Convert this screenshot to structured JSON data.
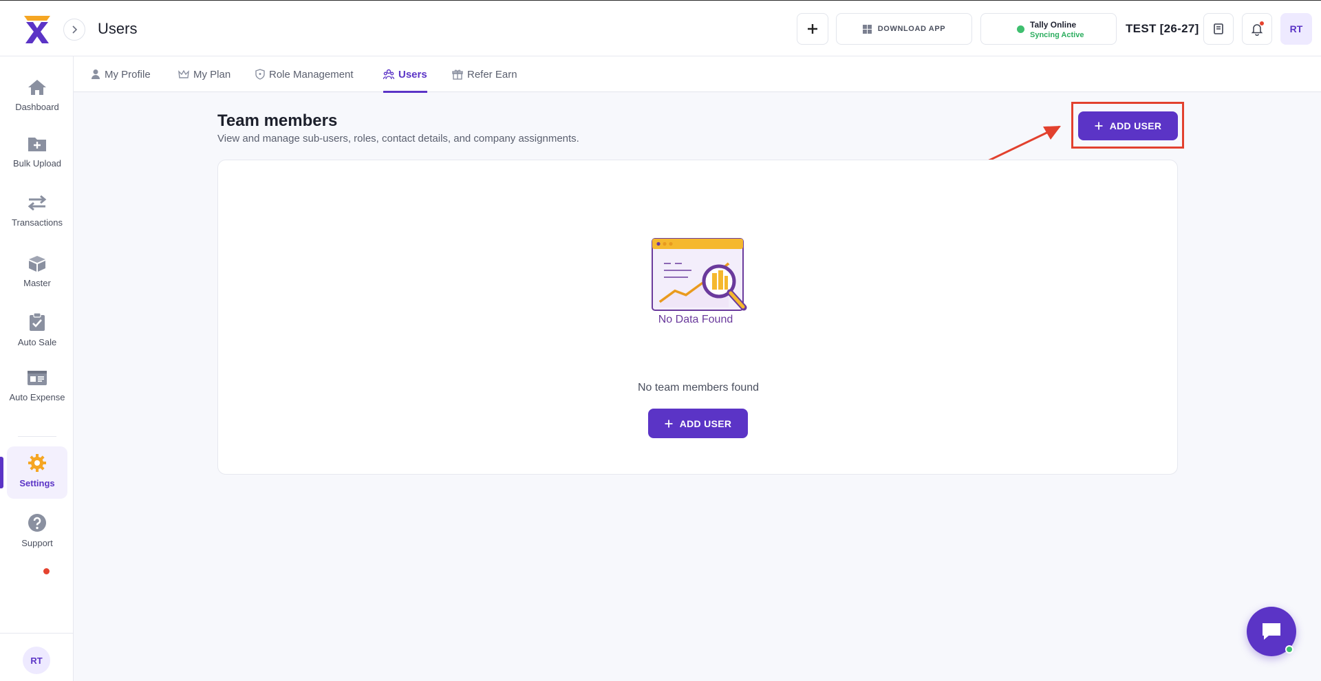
{
  "header": {
    "title": "Users",
    "download_label": "DOWNLOAD APP",
    "tally_status": "Tally Online",
    "tally_sync": "Syncing Active",
    "company": "TEST [26-27]",
    "avatar_initials": "RT"
  },
  "sidebar": {
    "items": [
      {
        "label": "Dashboard",
        "icon": "home-icon"
      },
      {
        "label": "Bulk Upload",
        "icon": "folder-plus-icon"
      },
      {
        "label": "Transactions",
        "icon": "swap-arrows-icon"
      },
      {
        "label": "Master",
        "icon": "box-icon"
      },
      {
        "label": "Auto Sale",
        "icon": "clipboard-check-icon"
      },
      {
        "label": "Auto Expense",
        "icon": "id-card-icon"
      },
      {
        "label": "Settings",
        "icon": "gear-icon",
        "active": true
      },
      {
        "label": "Support",
        "icon": "help-icon"
      }
    ],
    "avatar_initials": "RT"
  },
  "tabs": [
    {
      "label": "My Profile",
      "icon": "user-icon"
    },
    {
      "label": "My Plan",
      "icon": "crown-icon"
    },
    {
      "label": "Role Management",
      "icon": "shield-icon"
    },
    {
      "label": "Users",
      "icon": "users-icon",
      "active": true
    },
    {
      "label": "Refer Earn",
      "icon": "gift-icon"
    }
  ],
  "main": {
    "title": "Team members",
    "subtitle": "View and manage sub-users, roles, contact details, and company assignments.",
    "add_user_label": "ADD USER",
    "empty_illustration_text": "No Data Found",
    "empty_message": "No team members found",
    "empty_add_user_label": "ADD USER"
  },
  "colors": {
    "brand": "#5b34c6",
    "accent_orange": "#f5a623",
    "annotation": "#e2412e",
    "online": "#3fbf6f"
  }
}
